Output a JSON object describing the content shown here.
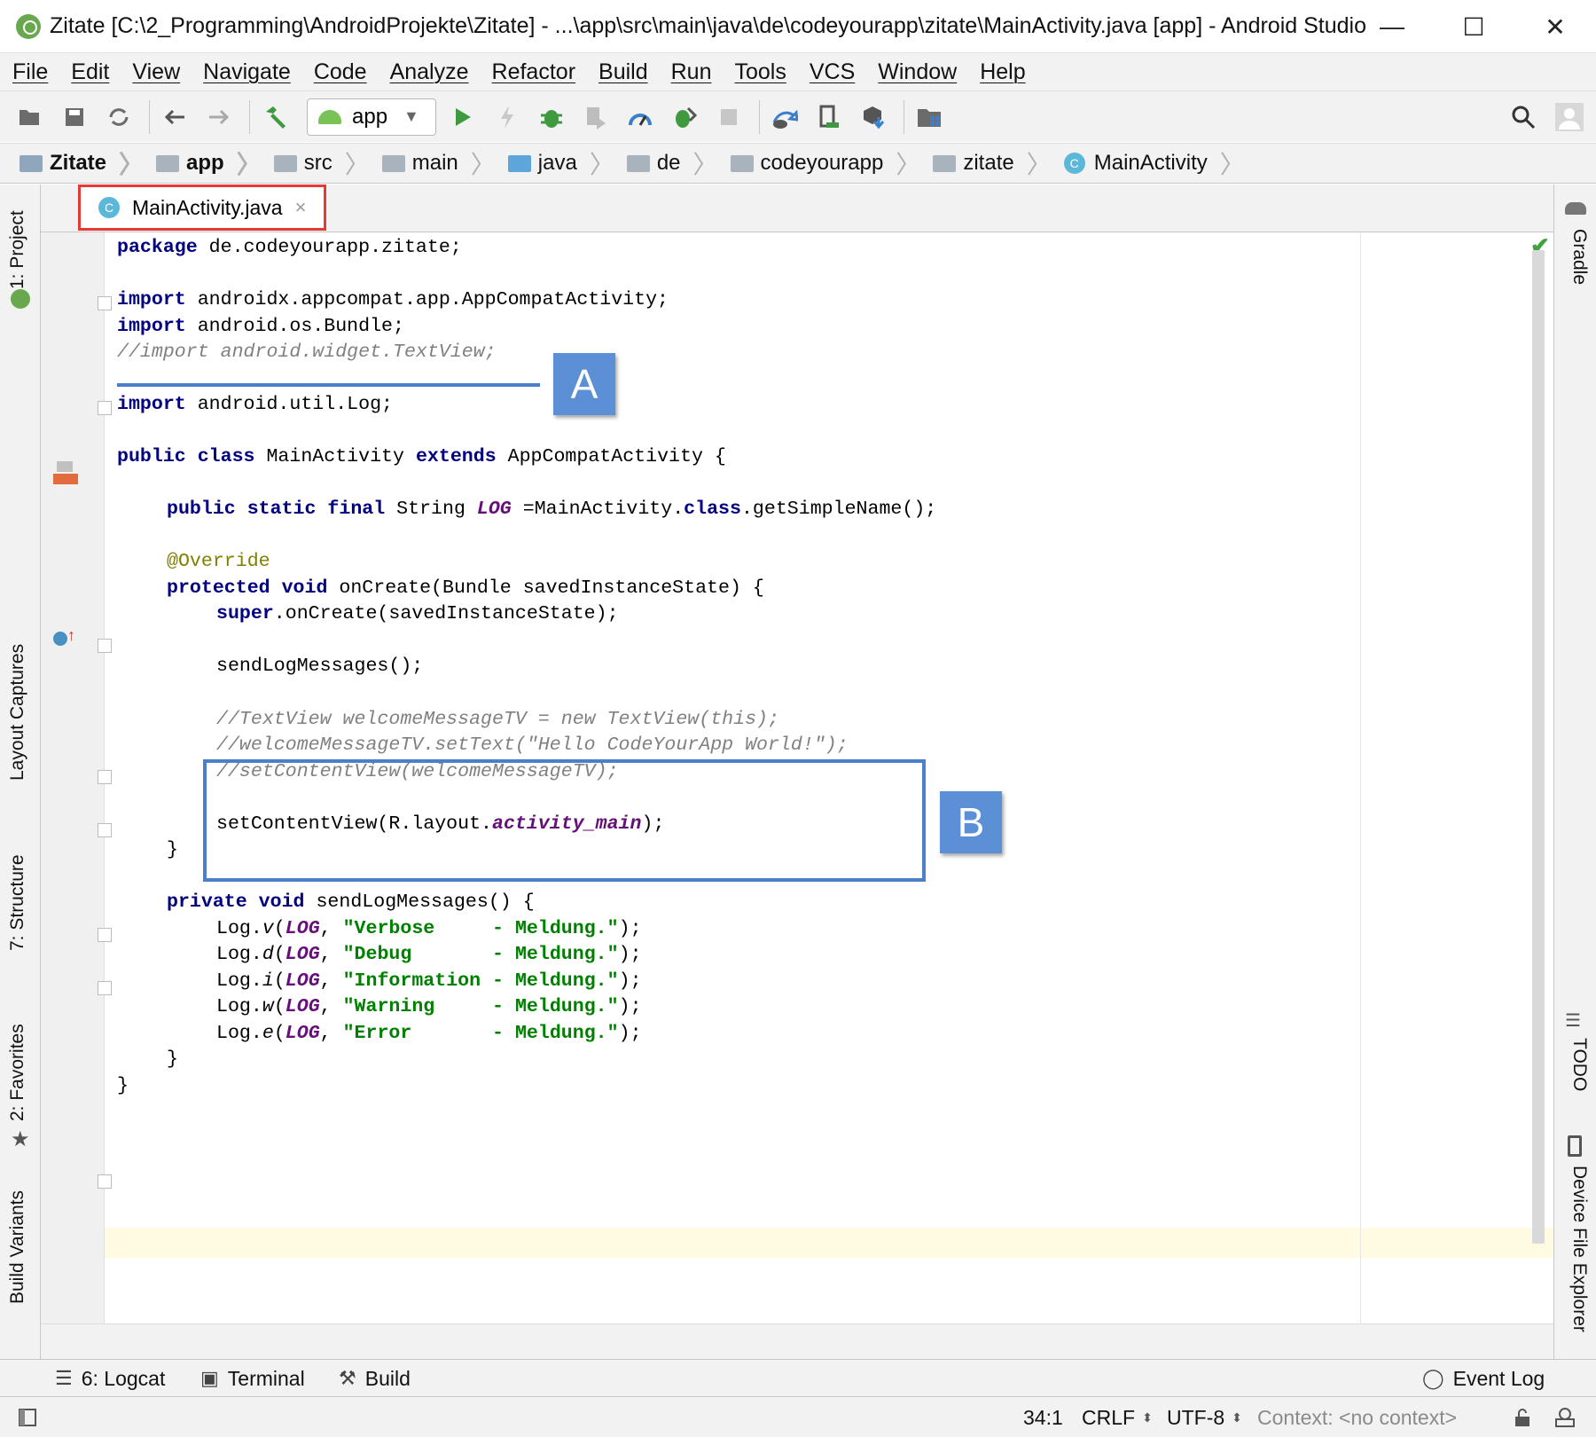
{
  "window": {
    "title": "Zitate [C:\\2_Programming\\AndroidProjekte\\Zitate] - ...\\app\\src\\main\\java\\de\\codeyourapp\\zitate\\MainActivity.java [app] - Android Studio",
    "minimize": "—",
    "maximize": "☐",
    "close": "✕"
  },
  "menu": [
    "File",
    "Edit",
    "View",
    "Navigate",
    "Code",
    "Analyze",
    "Refactor",
    "Build",
    "Run",
    "Tools",
    "VCS",
    "Window",
    "Help"
  ],
  "toolbar": {
    "run_config": "app",
    "icons": [
      "open-icon",
      "save-icon",
      "sync-icon",
      "back-icon",
      "forward-icon",
      "make-icon",
      "run-icon",
      "apply-changes-icon",
      "debug-icon",
      "attach-debugger-icon",
      "profile-icon",
      "sdk-manager-icon",
      "stop-icon",
      "gradle-sync-icon",
      "avd-manager-icon",
      "sdk-icon",
      "project-structure-icon",
      "search-icon",
      "user-icon"
    ]
  },
  "breadcrumb": [
    "Zitate",
    "app",
    "src",
    "main",
    "java",
    "de",
    "codeyourapp",
    "zitate",
    "MainActivity"
  ],
  "tab": {
    "label": "MainActivity.java",
    "class_badge": "C",
    "close": "×"
  },
  "left_tools": [
    "1: Project",
    "Layout Captures",
    "7: Structure",
    "2: Favorites",
    "Build Variants"
  ],
  "right_tools": [
    "Gradle",
    "TODO",
    "Device File Explorer"
  ],
  "code": {
    "l1_kw": "package",
    "l1_rest": " de.codeyourapp.zitate;",
    "l3_kw": "import",
    "l3_rest": " androidx.appcompat.app.AppCompatActivity;",
    "l4_kw": "import",
    "l4_rest": " android.os.Bundle;",
    "l5_cm": "//import android.widget.TextView;",
    "l7_kw": "import",
    "l7_rest": " android.util.Log;",
    "l9_kw1": "public class",
    "l9_mid": " MainActivity ",
    "l9_kw2": "extends",
    "l9_rest": " AppCompatActivity {",
    "l11_kw": "public static final",
    "l11_mid": " String ",
    "l11_fld": "LOG",
    "l11_eq": " =MainActivity.",
    "l11_kw2": "class",
    "l11_rest": ".getSimpleName();",
    "l13_ann": "@Override",
    "l14_kw": "protected void",
    "l14_rest": " onCreate(Bundle savedInstanceState) {",
    "l15_kw": "super",
    "l15_rest": ".onCreate(savedInstanceState);",
    "l17": "sendLogMessages();",
    "l19_cm": "//TextView welcomeMessageTV = new TextView(this);",
    "l20_cm": "//welcomeMessageTV.setText(\"Hello CodeYourApp World!\");",
    "l21_cm": "//setContentView(welcomeMessageTV);",
    "l23_pre": "setContentView(R.layout.",
    "l23_fld": "activity_main",
    "l23_rest": ");",
    "l24": "}",
    "l26_kw": "private void",
    "l26_rest": " sendLogMessages() {",
    "log_lines": [
      {
        "pre": "Log.",
        "m": "v",
        "str": "\"Verbose     - Meldung.\""
      },
      {
        "pre": "Log.",
        "m": "d",
        "str": "\"Debug       - Meldung.\""
      },
      {
        "pre": "Log.",
        "m": "i",
        "str": "\"Information - Meldung.\""
      },
      {
        "pre": "Log.",
        "m": "w",
        "str": "\"Warning     - Meldung.\""
      },
      {
        "pre": "Log.",
        "m": "e",
        "str": "\"Error       - Meldung.\""
      }
    ],
    "log_fld": "LOG",
    "l32": "}",
    "l33": "}"
  },
  "markers": {
    "a": "A",
    "b": "B"
  },
  "bottom_tools": {
    "logcat": "6: Logcat",
    "terminal": "Terminal",
    "build": "Build",
    "event_log": "Event Log"
  },
  "status": {
    "position": "34:1",
    "line_sep": "CRLF",
    "encoding": "UTF-8",
    "context": "Context: <no context>"
  }
}
